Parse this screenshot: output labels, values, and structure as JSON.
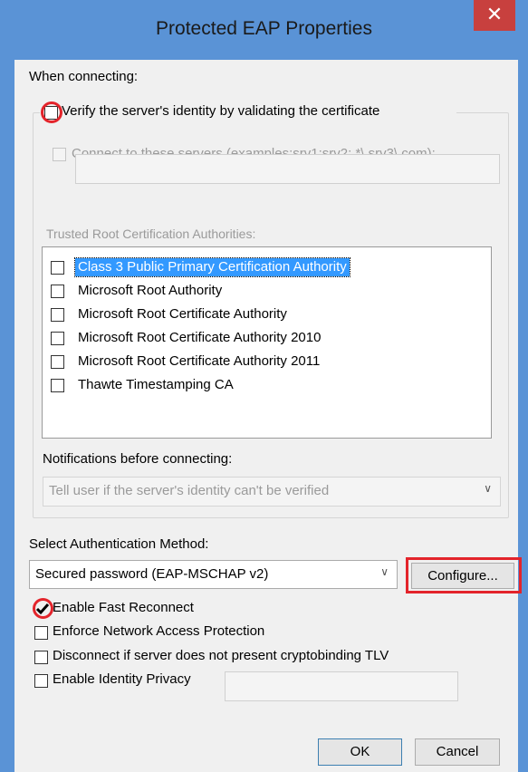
{
  "window": {
    "title": "Protected EAP Properties",
    "close_glyph": "✕"
  },
  "when_connecting": "When connecting:",
  "verify_identity": {
    "label": "Verify the server's identity by validating the certificate",
    "checked": false
  },
  "connect_servers": {
    "label": "Connect to these servers (examples:srv1;srv2;.*\\.srv3\\.com):",
    "value": ""
  },
  "trusted_root": {
    "label": "Trusted Root Certification Authorities:",
    "items": [
      "Class 3 Public Primary Certification Authority",
      "Microsoft Root Authority",
      "Microsoft Root Certificate Authority",
      "Microsoft Root Certificate Authority 2010",
      "Microsoft Root Certificate Authority 2011",
      "Thawte Timestamping CA"
    ]
  },
  "notifications": {
    "label": "Notifications before connecting:",
    "value": "Tell user if the server's identity can't be verified"
  },
  "auth_method": {
    "label": "Select Authentication Method:",
    "value": "Secured password (EAP-MSCHAP v2)",
    "configure_label": "Configure..."
  },
  "options": {
    "fast_reconnect": "Enable Fast Reconnect",
    "nap": "Enforce Network Access Protection",
    "cryptobinding": "Disconnect if server does not present cryptobinding TLV",
    "identity_privacy": "Enable Identity Privacy"
  },
  "buttons": {
    "ok": "OK",
    "cancel": "Cancel"
  },
  "colors": {
    "highlight": "#3399ff",
    "annotation": "#e3242b",
    "titlebar": "#5a93d6",
    "close": "#c8403e"
  }
}
